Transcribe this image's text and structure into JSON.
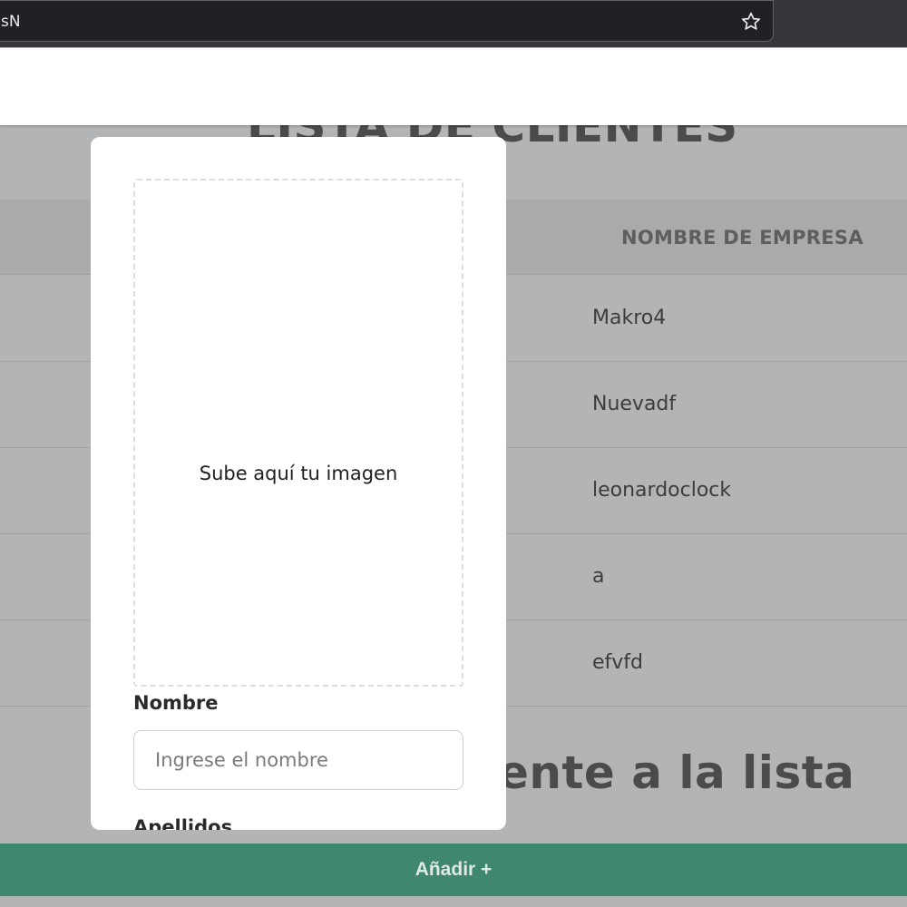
{
  "browser": {
    "url_fragment": "sN"
  },
  "page": {
    "title": "LISTA DE CLIENTES",
    "table": {
      "column_header": "NOMBRE DE EMPRESA",
      "rows": [
        "Makro4",
        "Nuevadf",
        "leonardoclock",
        "a",
        "efvfd"
      ]
    },
    "subtitle": "ente a la lista",
    "add_button_label": "Añadir +"
  },
  "modal": {
    "upload_text": "Sube aquí tu imagen",
    "name_label": "Nombre",
    "name_placeholder": "Ingrese el nombre",
    "name_value": "",
    "surname_label": "Apellidos"
  },
  "colors": {
    "accent": "#3f876e",
    "overlay": "#b3b4b6"
  }
}
